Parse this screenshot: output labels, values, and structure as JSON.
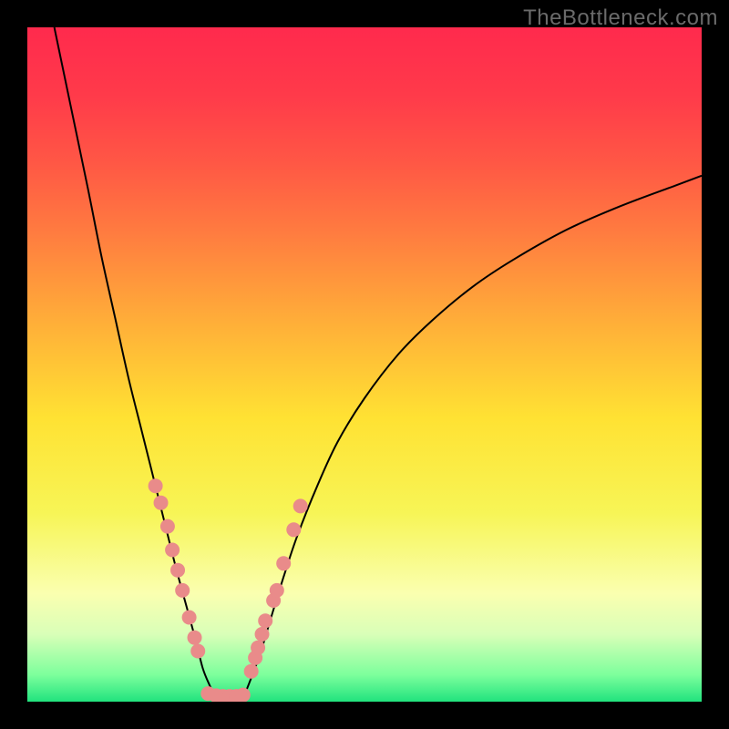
{
  "watermark": "TheBottleneck.com",
  "chart_data": {
    "type": "line",
    "title": "",
    "xlabel": "",
    "ylabel": "",
    "xlim": [
      0,
      100
    ],
    "ylim": [
      0,
      100
    ],
    "grid": false,
    "legend": false,
    "background_gradient_stops": [
      {
        "pct": 0,
        "color": "#ff2a4d"
      },
      {
        "pct": 10,
        "color": "#ff3a4a"
      },
      {
        "pct": 20,
        "color": "#ff5745"
      },
      {
        "pct": 30,
        "color": "#ff7a40"
      },
      {
        "pct": 45,
        "color": "#ffb338"
      },
      {
        "pct": 58,
        "color": "#ffe233"
      },
      {
        "pct": 72,
        "color": "#f7f556"
      },
      {
        "pct": 84,
        "color": "#faffb0"
      },
      {
        "pct": 90,
        "color": "#d9ffb8"
      },
      {
        "pct": 96,
        "color": "#7dff9c"
      },
      {
        "pct": 100,
        "color": "#21e37e"
      }
    ],
    "series": [
      {
        "name": "left-curve",
        "x": [
          4.0,
          6.5,
          9.0,
          11.0,
          13.0,
          15.0,
          17.0,
          19.0,
          20.5,
          22.0,
          23.5,
          25.0,
          26.0,
          27.0,
          28.0
        ],
        "values": [
          100.0,
          88.0,
          76.0,
          66.0,
          57.0,
          48.0,
          40.0,
          32.0,
          26.0,
          20.0,
          14.5,
          9.0,
          5.0,
          2.5,
          0.5
        ]
      },
      {
        "name": "right-curve",
        "x": [
          32.0,
          33.0,
          34.5,
          36.0,
          38.0,
          40.0,
          43.0,
          46.0,
          50.0,
          55.0,
          60.0,
          66.0,
          72.0,
          80.0,
          88.0,
          96.0,
          100.0
        ],
        "values": [
          0.5,
          3.0,
          7.0,
          12.0,
          18.5,
          24.5,
          32.0,
          38.5,
          45.0,
          51.5,
          56.5,
          61.5,
          65.5,
          70.0,
          73.5,
          76.5,
          78.0
        ]
      },
      {
        "name": "valley-floor",
        "x": [
          28.0,
          32.0
        ],
        "values": [
          0.5,
          0.5
        ]
      }
    ],
    "markers": {
      "color": "#e98b8a",
      "radius": 8,
      "points_left": [
        [
          19.0,
          32.0
        ],
        [
          19.8,
          29.5
        ],
        [
          20.8,
          26.0
        ],
        [
          21.5,
          22.5
        ],
        [
          22.3,
          19.5
        ],
        [
          23.0,
          16.5
        ],
        [
          24.0,
          12.5
        ],
        [
          24.8,
          9.5
        ],
        [
          25.3,
          7.5
        ]
      ],
      "points_right": [
        [
          33.2,
          4.5
        ],
        [
          33.8,
          6.5
        ],
        [
          34.2,
          8.0
        ],
        [
          34.8,
          10.0
        ],
        [
          35.3,
          12.0
        ],
        [
          36.5,
          15.0
        ],
        [
          37.0,
          16.5
        ],
        [
          38.0,
          20.5
        ],
        [
          39.5,
          25.5
        ],
        [
          40.5,
          29.0
        ]
      ],
      "points_floor": [
        [
          26.8,
          1.2
        ],
        [
          28.0,
          0.9
        ],
        [
          29.0,
          0.8
        ],
        [
          30.0,
          0.8
        ],
        [
          31.0,
          0.8
        ],
        [
          32.0,
          1.0
        ]
      ]
    }
  }
}
